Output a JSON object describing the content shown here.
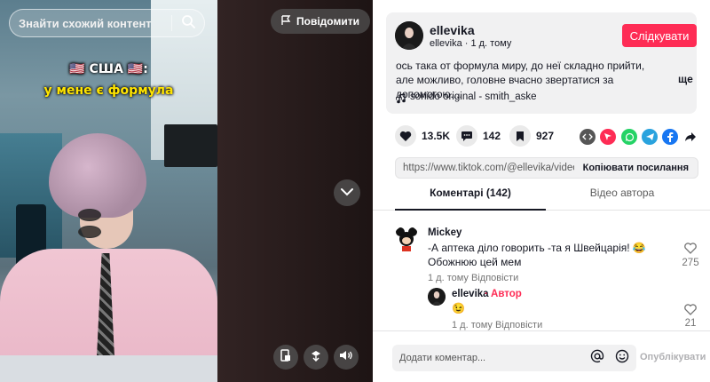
{
  "video": {
    "search_placeholder": "Знайти схожий контент",
    "report_label": "Повідомити",
    "caption_line1": "🇺🇸 США 🇺🇸:",
    "caption_line2": "у мене є формула"
  },
  "post": {
    "username": "ellevika",
    "subtitle": "ellevika · 1 д. тому",
    "follow_label": "Слідкувати",
    "description": "ось така от формула миру, до неї складно прийти, але можливо, головне вчасно звертатися за допомогою....",
    "more_label": "ще",
    "sound": "sonido original - smith_aske"
  },
  "stats": {
    "likes": "13.5K",
    "comments": "142",
    "saves": "927"
  },
  "share": {
    "url": "https://www.tiktok.com/@ellevika/video...",
    "copy_label": "Копіювати посилання"
  },
  "tabs": {
    "comments": "Коментарі (142)",
    "author_videos": "Відео автора"
  },
  "comments": [
    {
      "author": "Mickey",
      "text": "-А аптека діло говорить -та я Швейцарія! 😂 Обожнюю цей мем",
      "time": "1 д. тому",
      "reply_label": "Відповісти",
      "likes": "275"
    }
  ],
  "reply": {
    "author": "ellevika",
    "author_tag": "· Автор",
    "text": "😉",
    "time": "1 д. тому",
    "reply_label": "Відповісти",
    "likes": "21"
  },
  "composer": {
    "placeholder": "Додати коментар...",
    "publish_label": "Опублікувати"
  },
  "colors": {
    "accent": "#fe2c55",
    "author_tag": "#fe2c55"
  }
}
